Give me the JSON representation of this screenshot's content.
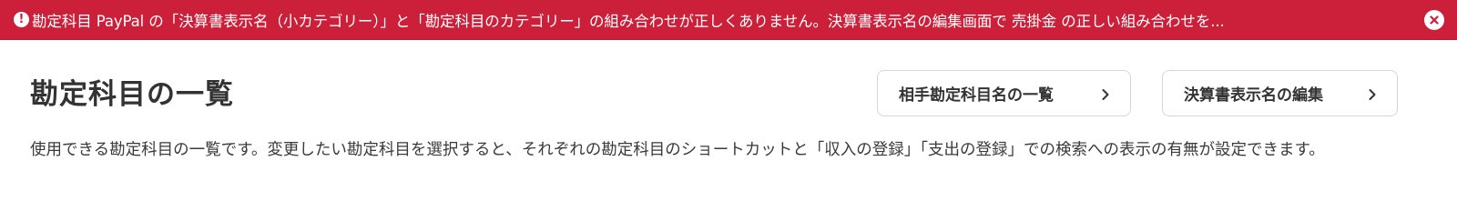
{
  "alert": {
    "icon": "exclamation-icon",
    "icon_glyph": "!",
    "message": "勘定科目 PayPal の「決算書表示名（小カテゴリー）」と「勘定科目のカテゴリー」の組み合わせが正しくありません。決算書表示名の編集画面で 売掛金 の正しい組み合わせを...",
    "close_icon": "close-icon",
    "background_color": "#cc1f3a"
  },
  "header": {
    "title": "勘定科目の一覧",
    "buttons": [
      {
        "label": "相手勘定科目名の一覧",
        "icon": "chevron-right-icon"
      },
      {
        "label": "決算書表示名の編集",
        "icon": "chevron-right-icon"
      }
    ]
  },
  "description": "使用できる勘定科目の一覧です。変更したい勘定科目を選択すると、それぞれの勘定科目のショートカットと「収入の登録」「支出の登録」での検索への表示の有無が設定できます。"
}
